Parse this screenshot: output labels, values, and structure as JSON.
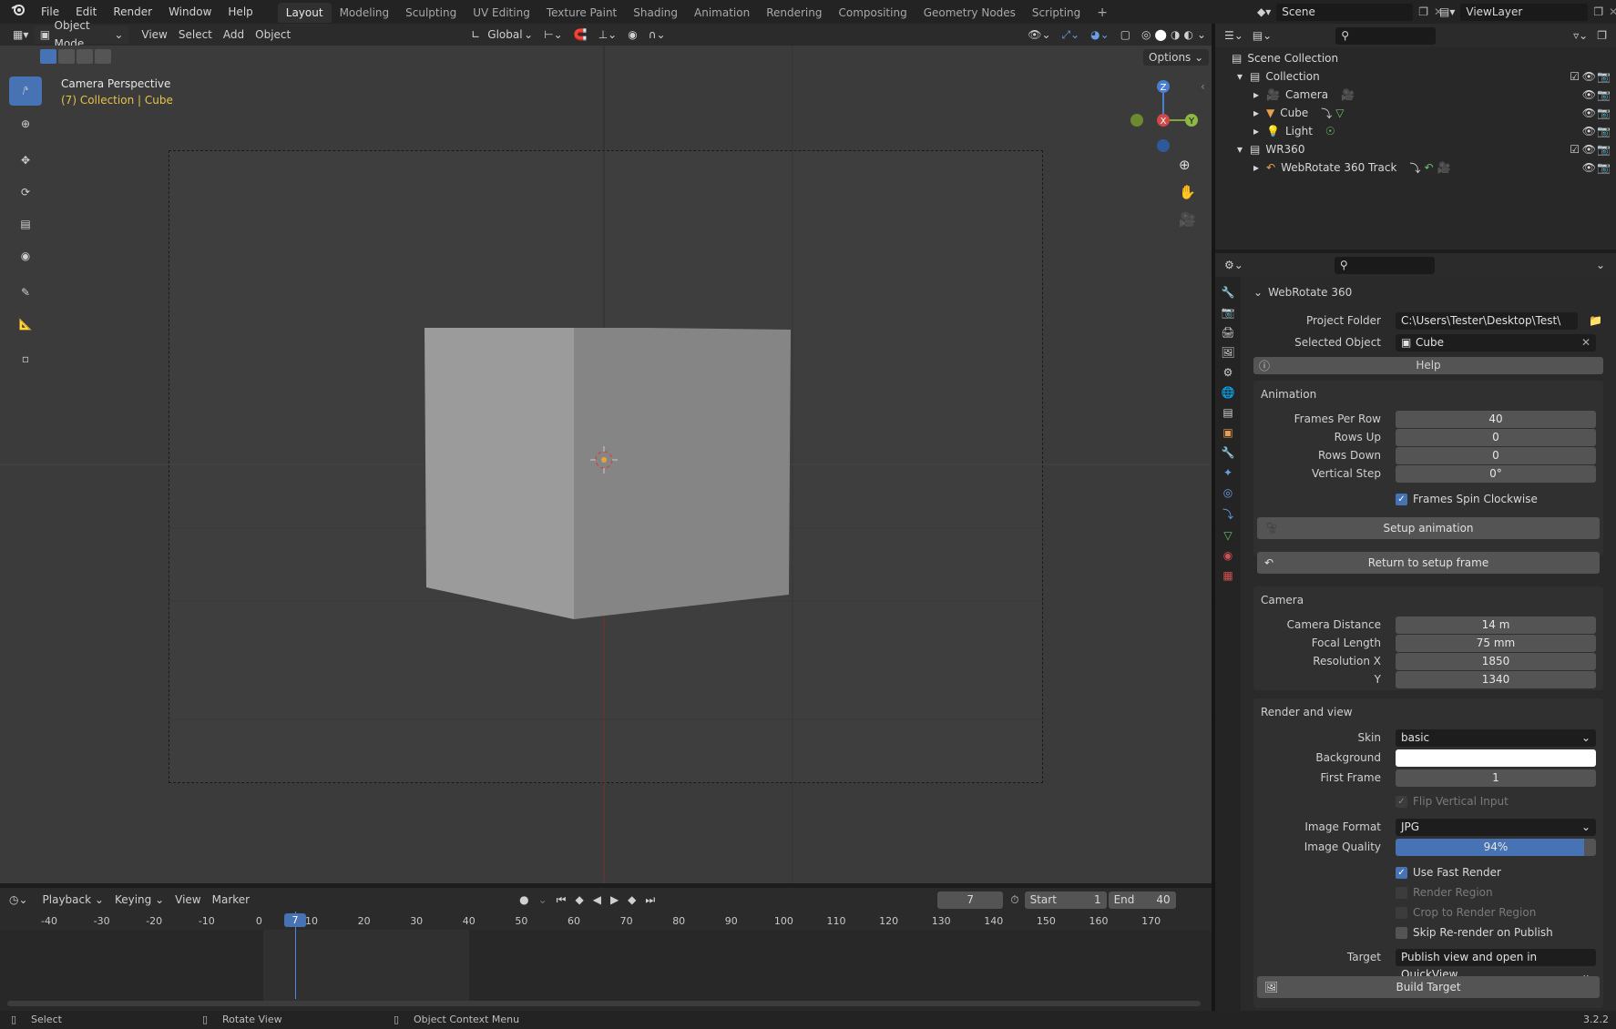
{
  "app": {
    "version": "3.2.2",
    "menus": [
      "File",
      "Edit",
      "Render",
      "Window",
      "Help"
    ],
    "workspaces": [
      "Layout",
      "Modeling",
      "Sculpting",
      "UV Editing",
      "Texture Paint",
      "Shading",
      "Animation",
      "Rendering",
      "Compositing",
      "Geometry Nodes",
      "Scripting"
    ],
    "active_workspace": "Layout",
    "add_workspace": "+",
    "scene": "Scene",
    "view_layer": "ViewLayer"
  },
  "viewport": {
    "mode": "Object Mode",
    "menus": [
      "View",
      "Select",
      "Add",
      "Object"
    ],
    "orientation": "Global",
    "options": "Options",
    "title": "Camera Perspective",
    "subtitle": "(7) Collection | Cube",
    "gizmo": {
      "z": "Z",
      "y": "Y",
      "x": "X"
    }
  },
  "outliner": {
    "root": "Scene Collection",
    "items": [
      {
        "name": "Collection",
        "level": 1
      },
      {
        "name": "Camera",
        "level": 2
      },
      {
        "name": "Cube",
        "level": 2
      },
      {
        "name": "Light",
        "level": 2
      },
      {
        "name": "WR360",
        "level": 1
      },
      {
        "name": "WebRotate 360 Track",
        "level": 2
      }
    ]
  },
  "properties": {
    "panel_title": "WebRotate 360",
    "project_folder_label": "Project Folder",
    "project_folder": "C:\\Users\\Tester\\Desktop\\Test\\",
    "selected_object_label": "Selected Object",
    "selected_object": "Cube",
    "help": "Help",
    "animation": {
      "title": "Animation",
      "frames_per_row_label": "Frames Per Row",
      "frames_per_row": "40",
      "rows_up_label": "Rows Up",
      "rows_up": "0",
      "rows_down_label": "Rows Down",
      "rows_down": "0",
      "vertical_step_label": "Vertical Step",
      "vertical_step": "0°",
      "spin_clockwise": "Frames Spin Clockwise",
      "setup": "Setup animation",
      "return": "Return to setup frame"
    },
    "camera": {
      "title": "Camera",
      "distance_label": "Camera Distance",
      "distance": "14 m",
      "focal_label": "Focal Length",
      "focal": "75 mm",
      "res_x_label": "Resolution X",
      "res_x": "1850",
      "res_y_label": "Y",
      "res_y": "1340"
    },
    "render": {
      "title": "Render and view",
      "skin_label": "Skin",
      "skin": "basic",
      "background_label": "Background",
      "background_color": "#ffffff",
      "first_frame_label": "First Frame",
      "first_frame": "1",
      "flip_vertical": "Flip Vertical Input",
      "image_format_label": "Image Format",
      "image_format": "JPG",
      "image_quality_label": "Image Quality",
      "image_quality": "94%",
      "image_quality_value": 0.94,
      "fast_render": "Use Fast Render",
      "render_region": "Render Region",
      "crop_region": "Crop to Render Region",
      "skip_rerender": "Skip Re-render on Publish",
      "target_label": "Target",
      "target": "Publish view and open in QuickView",
      "build": "Build Target"
    }
  },
  "timeline": {
    "menus": [
      "Playback",
      "Keying",
      "View",
      "Marker"
    ],
    "current_frame": "7",
    "start_label": "Start",
    "start": "1",
    "end_label": "End",
    "end": "40",
    "ticks": [
      "-40",
      "-30",
      "-20",
      "-10",
      "0",
      "10",
      "20",
      "30",
      "40",
      "50",
      "60",
      "70",
      "80",
      "90",
      "100",
      "110",
      "120",
      "130",
      "140",
      "150",
      "160",
      "170"
    ]
  },
  "status": {
    "select": "Select",
    "rotate": "Rotate View",
    "context": "Object Context Menu"
  },
  "colors": {
    "accent": "#4772b3",
    "subtitle": "#e5c24a"
  }
}
